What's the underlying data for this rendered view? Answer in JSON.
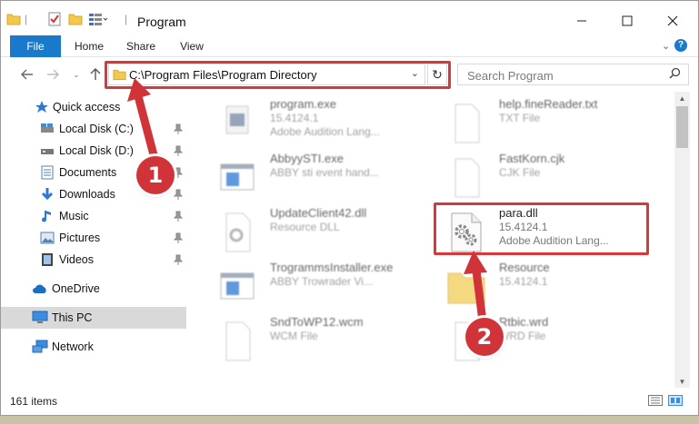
{
  "window": {
    "title": "Program"
  },
  "ribbon": {
    "tabs": [
      "File",
      "Home",
      "Share",
      "View"
    ]
  },
  "address": {
    "path": "C:\\Program Files\\Program Directory"
  },
  "search": {
    "placeholder": "Search Program"
  },
  "navpane": {
    "items": [
      {
        "label": "Quick access",
        "icon": "star-icon"
      },
      {
        "label": "Local Disk (C:)",
        "icon": "drive-icon"
      },
      {
        "label": "Local Disk (D:)",
        "icon": "drive-icon"
      },
      {
        "label": "Documents",
        "icon": "documents-icon"
      },
      {
        "label": "Downloads",
        "icon": "download-icon"
      },
      {
        "label": "Music",
        "icon": "music-icon"
      },
      {
        "label": "Pictures",
        "icon": "pictures-icon"
      },
      {
        "label": "Videos",
        "icon": "videos-icon"
      },
      {
        "label": "OneDrive",
        "icon": "cloud-icon"
      },
      {
        "label": "This PC",
        "icon": "computer-icon"
      },
      {
        "label": "Network",
        "icon": "network-icon"
      }
    ]
  },
  "files": [
    {
      "name": "program.exe",
      "line1": "15.4124.1",
      "line2": "Adobe Audition Lang..."
    },
    {
      "name": "help.fineReader.txt",
      "line1": "TXT File",
      "line2": ""
    },
    {
      "name": "AbbyySTI.exe",
      "line1": "ABBY sti event hand...",
      "line2": ""
    },
    {
      "name": "FastKorn.cjk",
      "line1": "CJK File",
      "line2": ""
    },
    {
      "name": "UpdateClient42.dll",
      "line1": "Resource DLL",
      "line2": ""
    },
    {
      "name": "para.dll",
      "line1": "15.4124.1",
      "line2": "Adobe Audition Lang..."
    },
    {
      "name": "TrogrammsInstaller.exe",
      "line1": "ABBY Trowrader Vi...",
      "line2": ""
    },
    {
      "name": "Resource",
      "line1": "15.4124.1",
      "line2": ""
    },
    {
      "name": "SndToWP12.wcm",
      "line1": "WCM File",
      "line2": ""
    },
    {
      "name": "Rtbic.wrd",
      "line1": "WRD File",
      "line2": ""
    }
  ],
  "status": {
    "item_count": "161 items"
  },
  "callouts": [
    "1",
    "2"
  ],
  "colors": {
    "accent": "#1979ca",
    "highlight": "#d9383a",
    "badge": "#d13438"
  }
}
